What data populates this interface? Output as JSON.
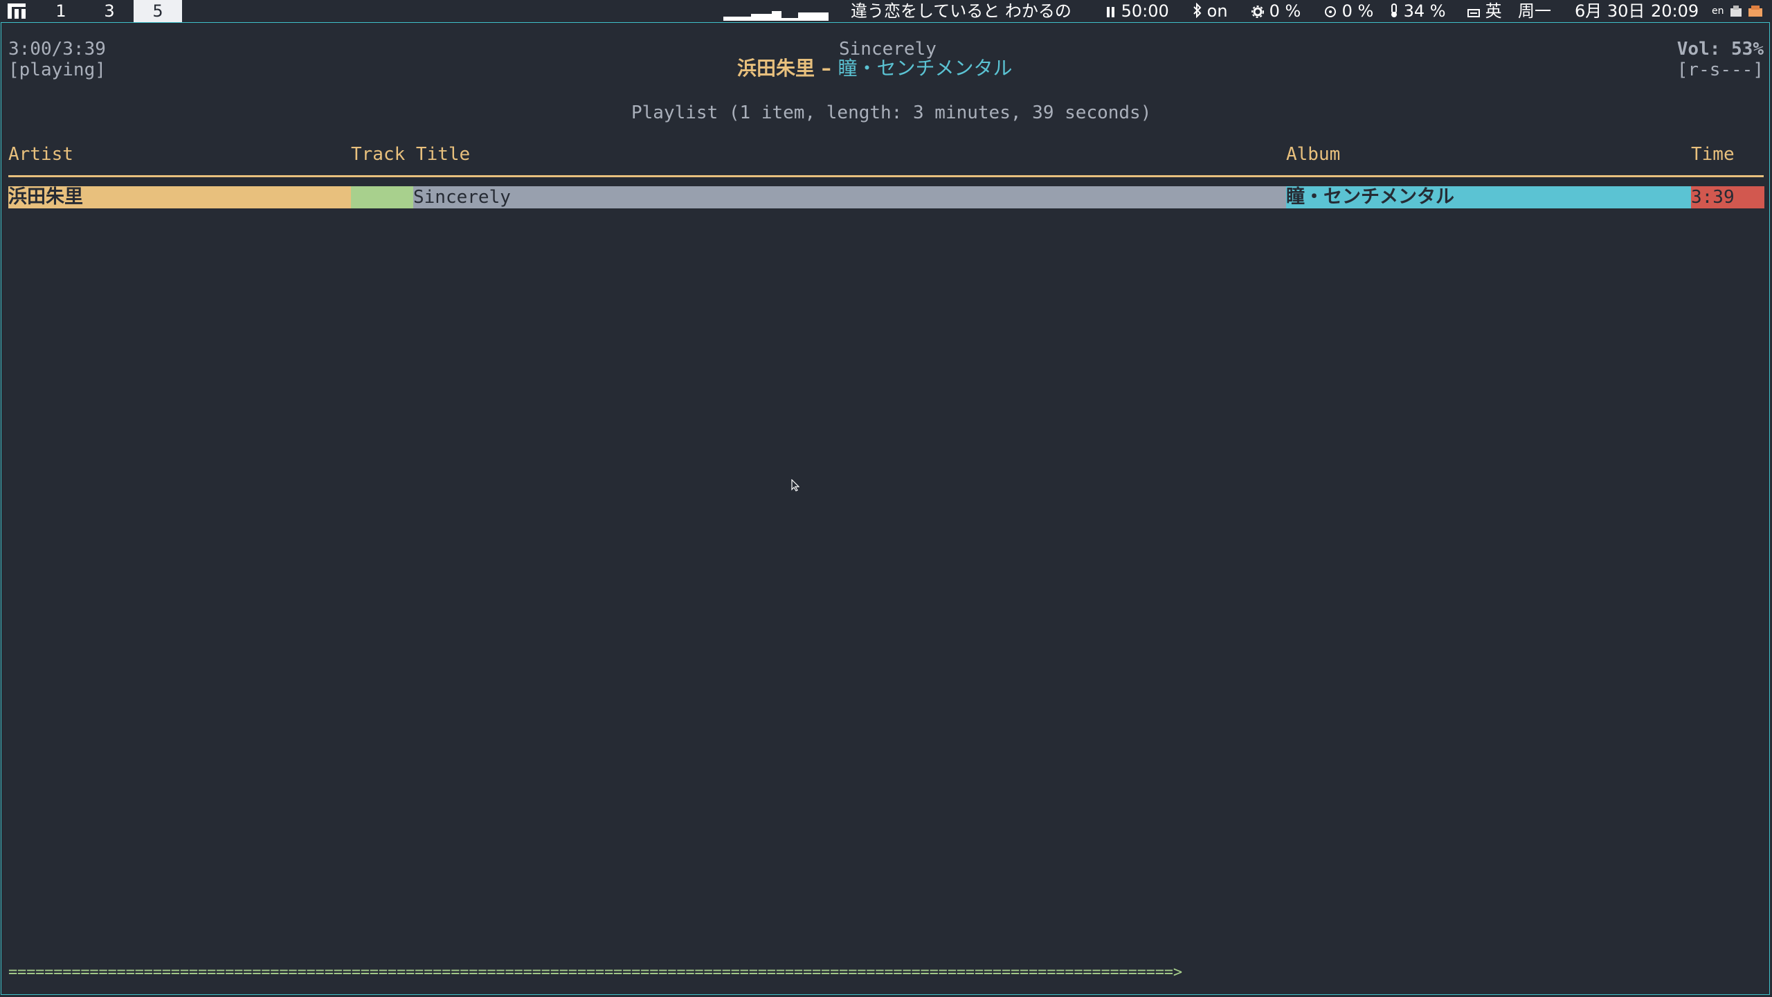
{
  "statusbar": {
    "workspaces": [
      "1",
      "3",
      "5"
    ],
    "active_workspace": "5",
    "now_playing": "違う恋をしていると わかるの",
    "timer": "50:00",
    "bluetooth": "on",
    "cpu": "0 %",
    "disk": "0 %",
    "battery": "34 %",
    "input_method": "英",
    "weekday": "周一",
    "date": "6月 30日",
    "time": "20:09",
    "locale": "en"
  },
  "player": {
    "elapsed_total": "3:00/3:39",
    "state": "[playing]",
    "song_title": "Sincerely",
    "artist": "浜田朱里",
    "separator": "–",
    "album": "瞳・センチメンタル",
    "volume": "Vol: 53%",
    "flags": "[r-s---]",
    "progress_fraction": 0.82,
    "progress_bar": "=================================================================================================================================>"
  },
  "playlist": {
    "summary": "Playlist (1 item, length: 3 minutes, 39 seconds)",
    "columns": {
      "artist": "Artist",
      "title": "Track Title",
      "album": "Album",
      "time": "Time"
    },
    "rows": [
      {
        "artist": "浜田朱里",
        "title": "Sincerely",
        "album": "瞳・センチメンタル",
        "time": "3:39"
      }
    ]
  },
  "colors": {
    "background": "#262b34",
    "accent_yellow": "#e8c07d",
    "accent_cyan": "#5bc3d3",
    "accent_green": "#a8d08d",
    "accent_red": "#d2584f",
    "row_gray": "#98a0ae",
    "window_border": "#3fc1c9"
  },
  "icons": {
    "wm": "wm-logo-icon",
    "pause": "pause-icon",
    "bluetooth": "bluetooth-icon",
    "cpu": "gear-icon",
    "disk": "disk-icon",
    "battery": "thermometer-icon",
    "keyboard": "keyboard-icon",
    "tray": "tray-icon"
  }
}
